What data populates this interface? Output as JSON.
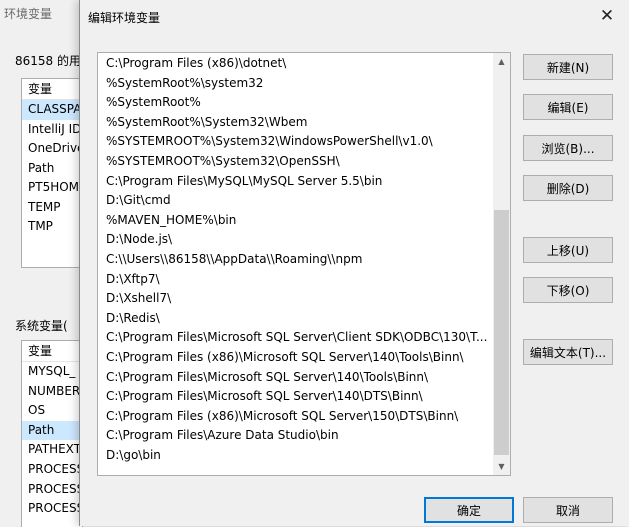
{
  "parent_window": {
    "title": "环境变量",
    "user_section_label": "86158 的用",
    "user_vars": {
      "header": "变量",
      "rows": [
        "CLASSPA",
        "IntelliJ ID",
        "OneDrive",
        "Path",
        "PT5HOM",
        "TEMP",
        "TMP"
      ],
      "selected_index": 0
    },
    "system_section_label": "系统变量(",
    "system_vars": {
      "header": "变量",
      "rows": [
        "MYSQL_",
        "NUMBER",
        "OS",
        "Path",
        "PATHEXT",
        "PROCESS",
        "PROCESS",
        "PROCESS"
      ],
      "selected_index": 3
    }
  },
  "dialog": {
    "title": "编辑环境变量",
    "close_glyph": "✕",
    "entries": [
      "C:\\Program Files (x86)\\dotnet\\",
      "%SystemRoot%\\system32",
      "%SystemRoot%",
      "%SystemRoot%\\System32\\Wbem",
      "%SYSTEMROOT%\\System32\\WindowsPowerShell\\v1.0\\",
      "%SYSTEMROOT%\\System32\\OpenSSH\\",
      "C:\\Program Files\\MySQL\\MySQL Server 5.5\\bin",
      "D:\\Git\\cmd",
      "%MAVEN_HOME%\\bin",
      "D:\\Node.js\\",
      "C:\\\\Users\\\\86158\\\\AppData\\\\Roaming\\\\npm",
      "D:\\Xftp7\\",
      "D:\\Xshell7\\",
      "D:\\Redis\\",
      "C:\\Program Files\\Microsoft SQL Server\\Client SDK\\ODBC\\130\\T...",
      "C:\\Program Files (x86)\\Microsoft SQL Server\\140\\Tools\\Binn\\",
      "C:\\Program Files\\Microsoft SQL Server\\140\\Tools\\Binn\\",
      "C:\\Program Files\\Microsoft SQL Server\\140\\DTS\\Binn\\",
      "C:\\Program Files (x86)\\Microsoft SQL Server\\150\\DTS\\Binn\\",
      "C:\\Program Files\\Azure Data Studio\\bin",
      "D:\\go\\bin"
    ],
    "buttons": {
      "new": "新建(N)",
      "edit": "编辑(E)",
      "browse": "浏览(B)...",
      "delete": "删除(D)",
      "move_up": "上移(U)",
      "move_down": "下移(O)",
      "edit_text": "编辑文本(T)...",
      "ok": "确定",
      "cancel": "取消"
    },
    "scrollbar": {
      "up_glyph": "▲",
      "down_glyph": "▼"
    },
    "colors": {
      "focus_border": "#0078d7",
      "selection": "#cce8ff"
    }
  }
}
